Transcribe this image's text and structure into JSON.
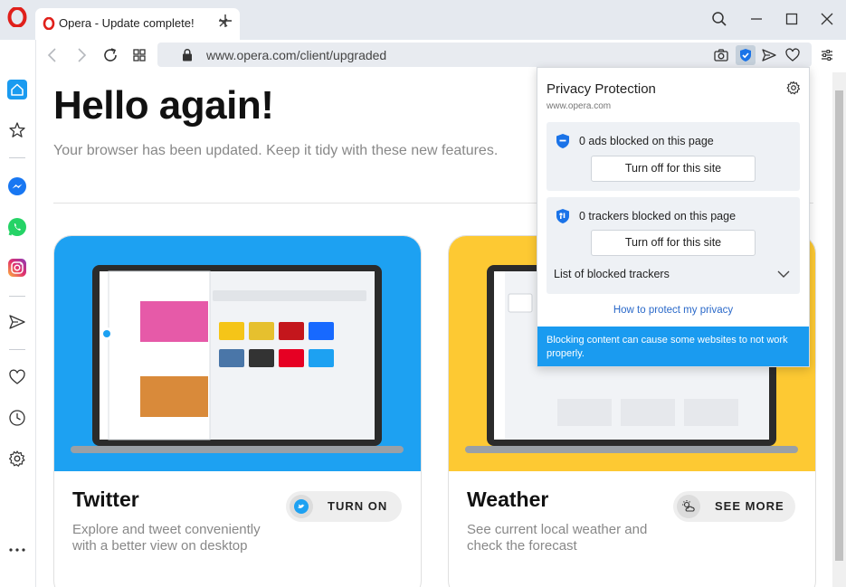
{
  "browser": {
    "tab": {
      "title": "Opera - Update complete!"
    },
    "address": {
      "url": "www.opera.com/client/upgraded"
    }
  },
  "page": {
    "heading": "Hello again!",
    "subtitle": "Your browser has been updated. Keep it tidy with these new features.",
    "cards": [
      {
        "title": "Twitter",
        "description": "Explore and tweet conveniently with a better view on desktop",
        "button_label": "TURN ON",
        "hero_color": "#1da1f2"
      },
      {
        "title": "Weather",
        "description": "See current local weather and check the forecast",
        "button_label": "SEE MORE",
        "hero_color": "#fdc933"
      }
    ]
  },
  "privacy_popup": {
    "title": "Privacy Protection",
    "site": "www.opera.com",
    "ads_blocked": "0 ads blocked on this page",
    "ads_button": "Turn off for this site",
    "trackers_blocked": "0 trackers blocked on this page",
    "trackers_button": "Turn off for this site",
    "list_label": "List of blocked trackers",
    "howto_link": "How to protect my privacy",
    "warning": "Blocking content can cause some websites to not work properly."
  },
  "colors": {
    "opera_red": "#e0201b",
    "accent_blue": "#1a9bf0",
    "link_blue": "#2a69c9"
  }
}
